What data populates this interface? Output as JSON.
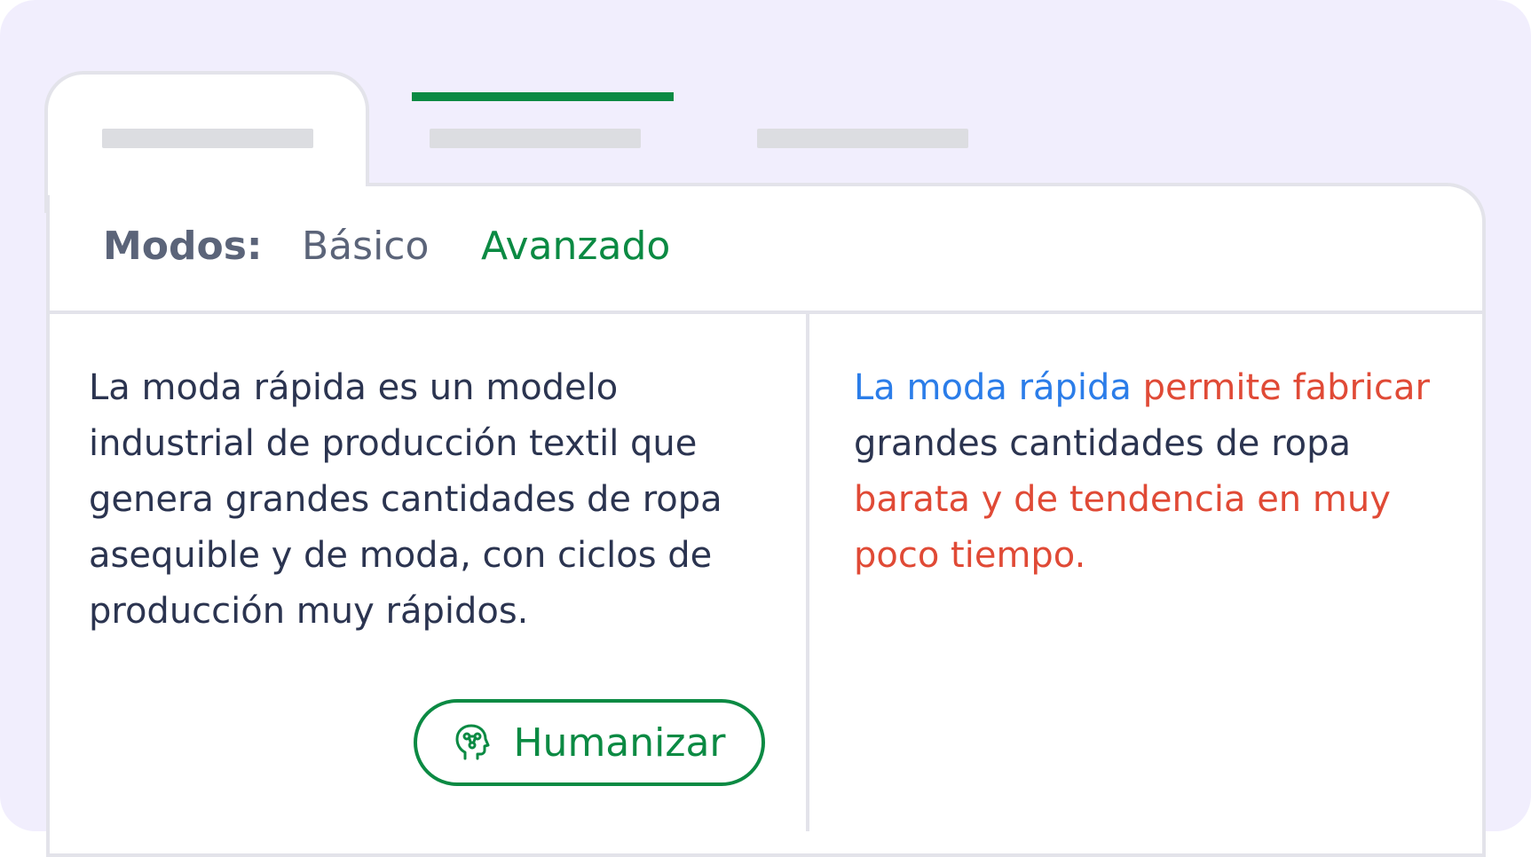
{
  "modes": {
    "label": "Modos:",
    "tabs": [
      {
        "label": "Básico",
        "active": false
      },
      {
        "label": "Avanzado",
        "active": true
      }
    ]
  },
  "input": {
    "text": "La moda rápida es un modelo industrial de producción textil que genera grandes cantidades de ropa asequible y de moda, con ciclos de producción muy rápidos."
  },
  "output": {
    "segments": [
      {
        "text": "La moda rápida",
        "style": "changed-blue"
      },
      {
        "text": "permite fabricar",
        "style": "changed-red"
      },
      {
        "text": "grandes cantidades de ropa",
        "style": "plain"
      },
      {
        "text": "barata y de tendencia en muy poco tiempo.",
        "style": "changed-red"
      }
    ]
  },
  "humanize_button": {
    "label": "Humanizar",
    "icon": "head-network-icon"
  },
  "colors": {
    "accent": "#0b8a43",
    "highlight_blue": "#2b7de9",
    "highlight_red": "#e04a36",
    "text": "#2b3450",
    "muted": "#5b6479",
    "background": "#f1eefd"
  }
}
